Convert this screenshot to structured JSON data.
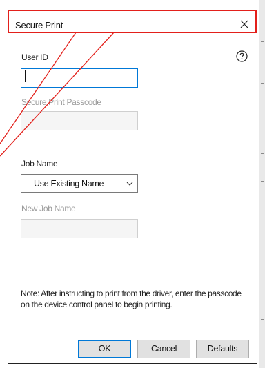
{
  "dialog": {
    "title": "Secure Print",
    "close_glyph": "X",
    "help_glyph": "?",
    "user_id": {
      "label": "User ID",
      "value": ""
    },
    "passcode": {
      "label": "Secure Print Passcode",
      "value": ""
    },
    "job_name": {
      "label": "Job Name",
      "selected": "Use Existing Name"
    },
    "new_job_name": {
      "label": "New Job Name",
      "value": ""
    },
    "note": "Note: After instructing to print from the driver, enter the passcode on the device control panel to begin printing.",
    "buttons": {
      "ok": "OK",
      "cancel": "Cancel",
      "defaults": "Defaults"
    }
  },
  "annotation": {
    "highlight_color": "#e3201b"
  },
  "colors": {
    "focus_border": "#0078d7",
    "disabled_text": "#9a9a9a"
  }
}
